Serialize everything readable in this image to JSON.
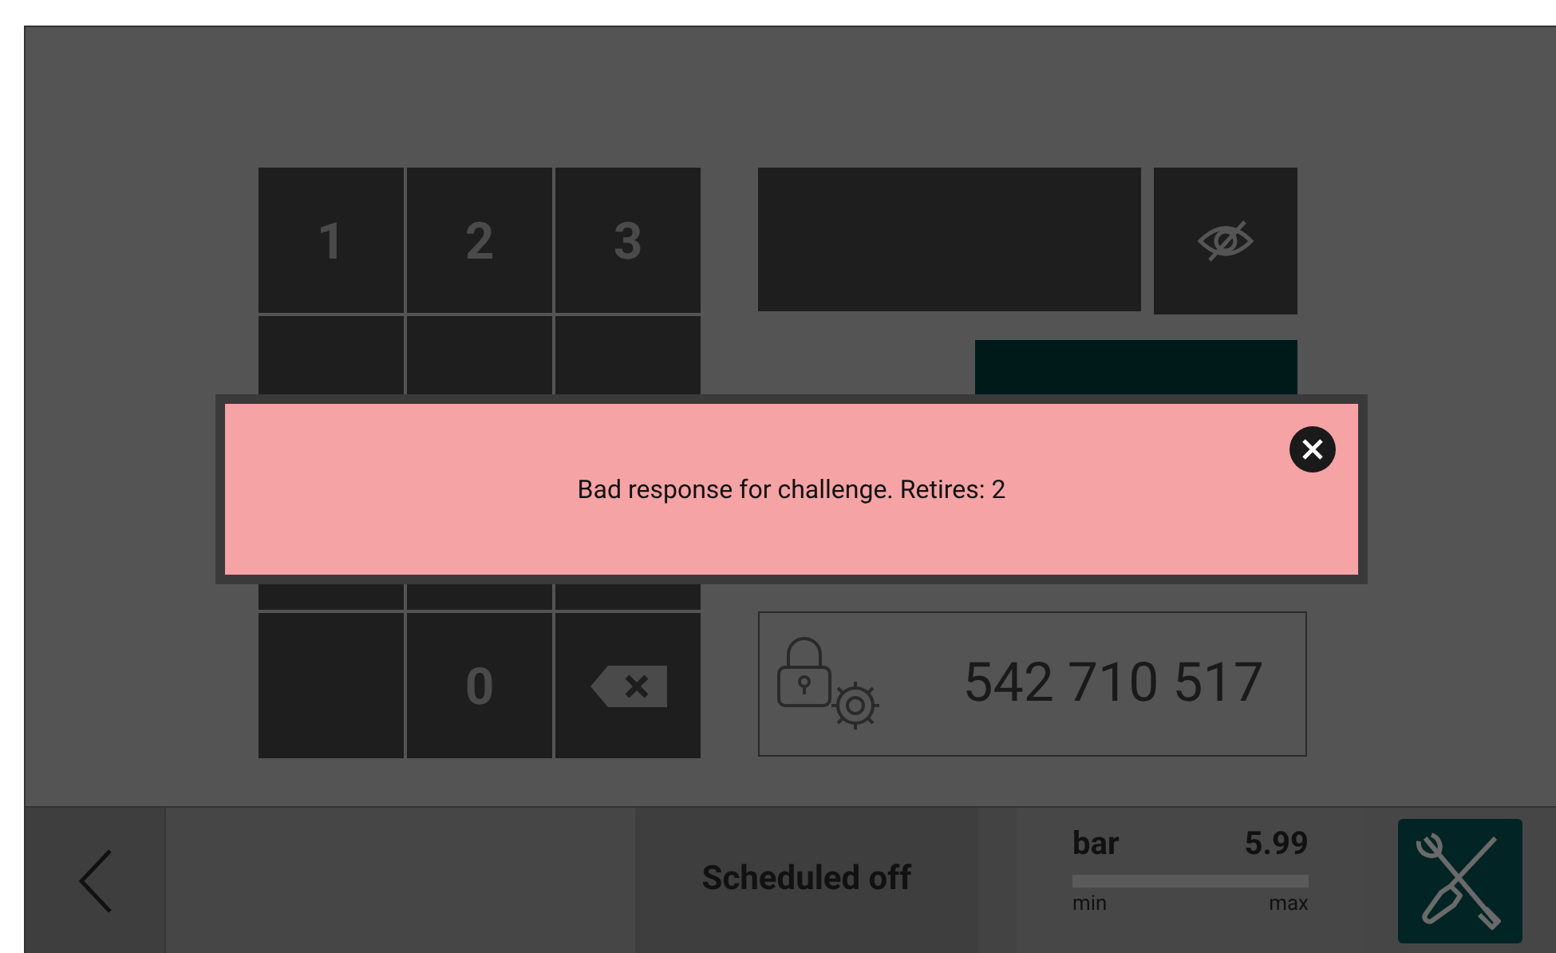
{
  "keypad": {
    "keys": [
      {
        "label": "1",
        "kind": "digit"
      },
      {
        "label": "2",
        "kind": "digit"
      },
      {
        "label": "3",
        "kind": "digit"
      },
      {
        "kind": "digit"
      },
      {
        "kind": "digit"
      },
      {
        "kind": "digit"
      },
      {
        "kind": "digit"
      },
      {
        "kind": "digit"
      },
      {
        "kind": "digit"
      },
      {
        "kind": "blank"
      },
      {
        "label": "0",
        "kind": "digit"
      },
      {
        "kind": "backspace"
      }
    ]
  },
  "challenge": {
    "code": "542 710 517"
  },
  "alert": {
    "message": "Bad response for challenge. Retires: 2"
  },
  "status_bar": {
    "status": "Scheduled off",
    "gauge": {
      "unit": "bar",
      "value": "5.99",
      "min_label": "min",
      "max_label": "max"
    }
  }
}
